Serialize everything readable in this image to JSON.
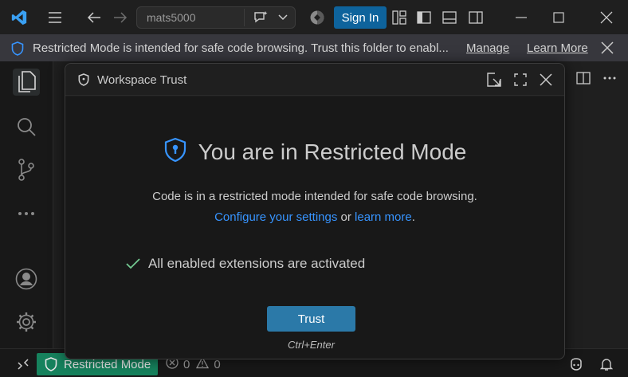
{
  "titlebar": {
    "search_text": "mats5000",
    "signin_label": "Sign In"
  },
  "banner": {
    "message": "Restricted Mode is intended for safe code browsing. Trust this folder to enabl...",
    "manage_label": "Manage",
    "learn_more_label": "Learn More"
  },
  "statusbar": {
    "restricted_label": "Restricted Mode",
    "errors": "0",
    "warnings": "0"
  },
  "dialog": {
    "title": "Workspace Trust",
    "heading": "You are in Restricted Mode",
    "description": "Code is in a restricted mode intended for safe code browsing.",
    "configure_link": "Configure your settings",
    "or_text": " or ",
    "learn_link": "learn more",
    "period": ".",
    "check_item": "All enabled extensions are activated",
    "trust_label": "Trust",
    "shortcut": "Ctrl+Enter"
  },
  "colors": {
    "accent_blue": "#0e639c",
    "trust_button": "#2b79a8",
    "restricted_green": "#16825d",
    "link": "#3794ff",
    "check_green": "#73c991"
  },
  "icons": [
    "vscode-logo-icon",
    "menu-icon",
    "back-arrow-icon",
    "forward-arrow-icon",
    "copilot-icon",
    "chevron-down-icon",
    "accounts-sync-icon",
    "layout-icon",
    "toggle-primary-sidebar-icon",
    "toggle-panel-icon",
    "toggle-secondary-sidebar-icon",
    "minimize-icon",
    "maximize-icon",
    "close-icon",
    "shield-icon",
    "explorer-icon",
    "search-icon",
    "source-control-icon",
    "more-icon",
    "account-icon",
    "gear-icon",
    "remote-icon",
    "error-icon",
    "warning-icon",
    "copilot-status-icon",
    "bell-icon",
    "popout-icon",
    "fullscreen-icon",
    "split-editor-icon",
    "check-icon"
  ]
}
